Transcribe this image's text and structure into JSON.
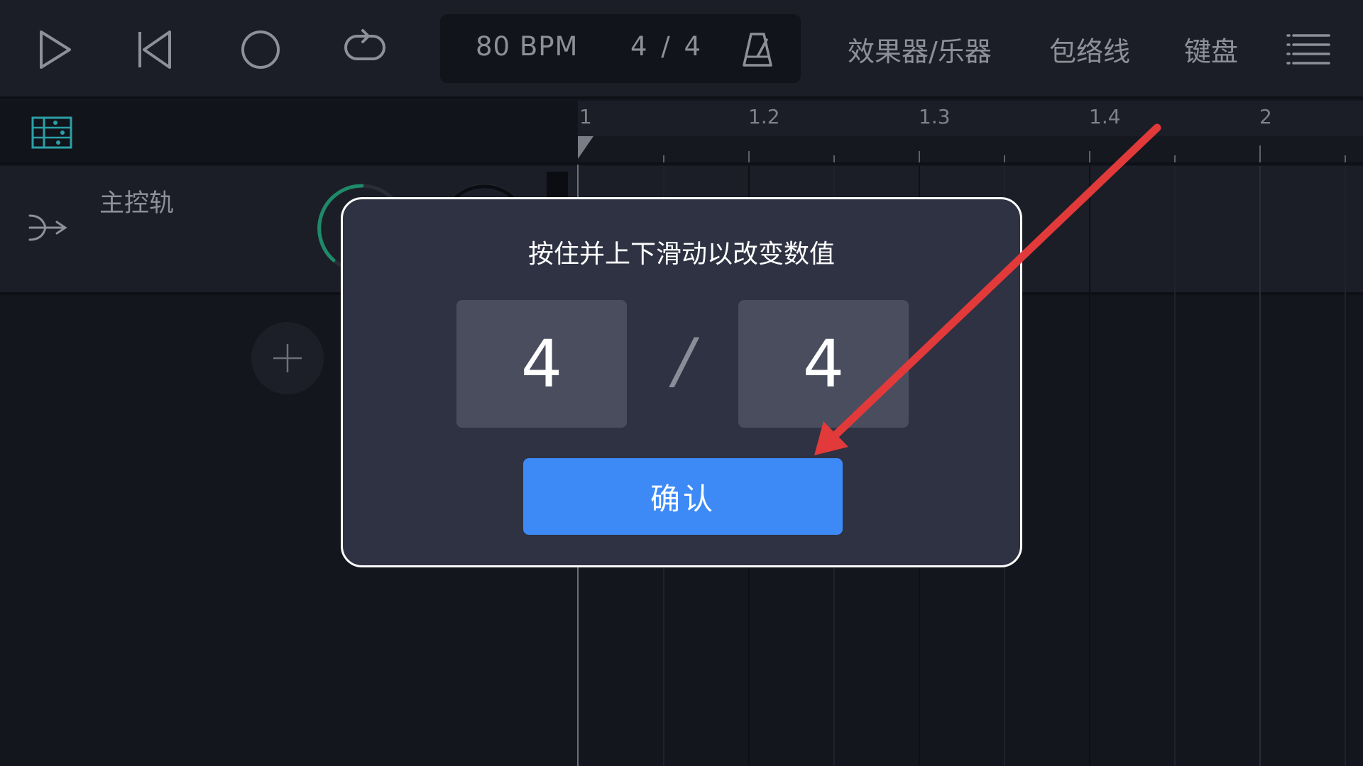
{
  "toolbar": {
    "bpm": "80  BPM",
    "time_signature": "4 / 4",
    "effects_instruments": "效果器/乐器",
    "envelope": "包络线",
    "keyboard": "键盘"
  },
  "master_track": {
    "label": "主控轨"
  },
  "ruler": {
    "labels": [
      "1",
      "1.2",
      "1.3",
      "1.4",
      "2"
    ]
  },
  "dialog": {
    "title": "按住并上下滑动以改变数值",
    "numerator": "4",
    "separator": "/",
    "denominator": "4",
    "confirm_label": "确认"
  },
  "colors": {
    "accent_blue": "#3d8af7",
    "dialog_bg": "#2e3242",
    "annotation_red": "#e23a3a",
    "knob_green": "#1f8a6a",
    "mixer_teal": "#2c9fa6"
  }
}
